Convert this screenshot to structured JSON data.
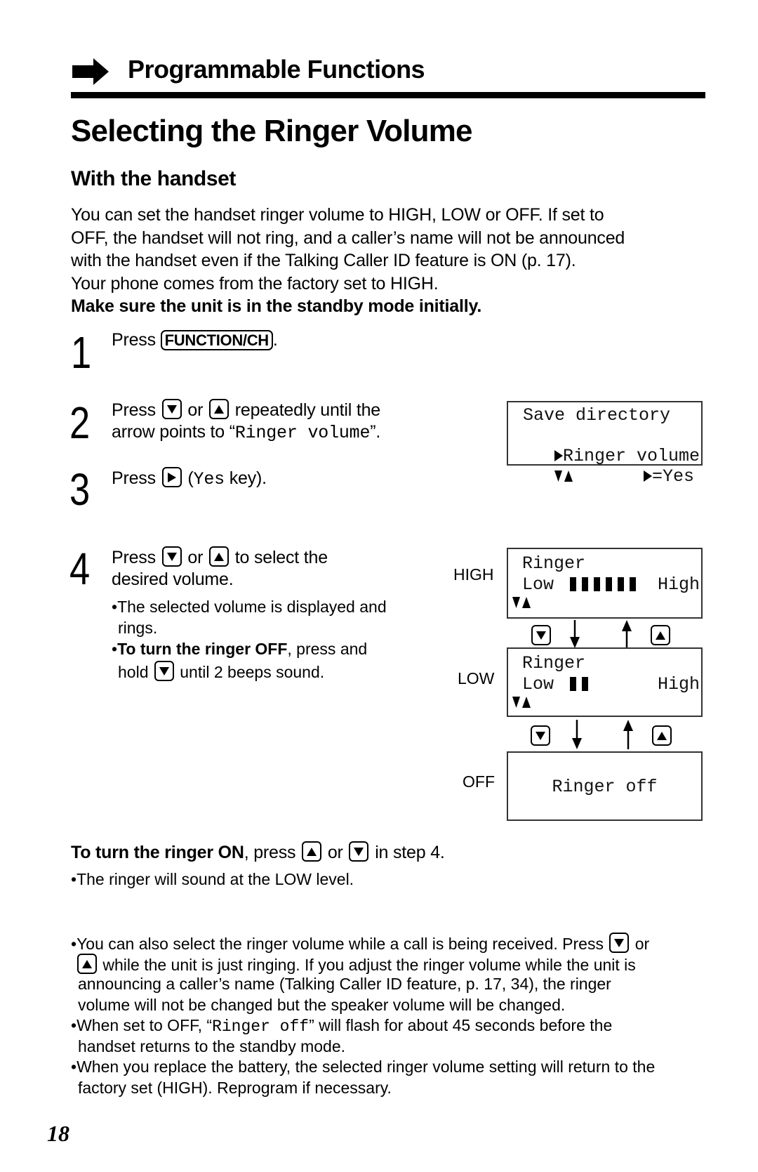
{
  "header": {
    "icon": "right-arrow-icon",
    "section": "Programmable Functions"
  },
  "title": "Selecting the Ringer Volume",
  "subheading": "With the handset",
  "intro": {
    "lines": [
      "You can set the handset ringer volume to HIGH, LOW or OFF. If set to",
      "OFF, the handset will not ring, and a caller’s name will not be announced",
      "with the handset even if the Talking Caller ID feature is ON (p. 17).",
      "Your phone comes from the factory set to HIGH."
    ],
    "bold_note": "Make sure the unit is in the standby mode initially."
  },
  "steps": [
    {
      "number": "1",
      "press": "Press",
      "key": "FUNCTION/CH",
      "after": "."
    },
    {
      "number": "2",
      "press": "Press",
      "or": "or",
      "line1_after": "repeatedly until the",
      "line2_before": "arrow points to “",
      "line2_mono": "Ringer volume",
      "line2_after": "”."
    },
    {
      "number": "3",
      "press": "Press",
      "paren_open": "(",
      "mono": "Yes",
      "after": " key)."
    },
    {
      "number": "4",
      "press": "Press",
      "or": "or",
      "line1_after": "to select the",
      "line2": "desired volume.",
      "bullets": [
        {
          "line1": "The selected volume is displayed and",
          "line2": "rings."
        },
        {
          "bold": "To turn the ringer OFF",
          "rest": ", press and",
          "line2_before": "hold",
          "line2_after": "until 2 beeps sound."
        }
      ]
    }
  ],
  "displays": {
    "menu": {
      "line1": " Save directory",
      "line2": "Ringer volume",
      "line3_right": "=Yes"
    },
    "high": {
      "label": "HIGH",
      "line1": "Ringer",
      "low": "Low",
      "high": "High",
      "level_bars": 6
    },
    "low": {
      "label": "LOW",
      "line1": "Ringer",
      "low": "Low",
      "high": "High",
      "level_bars": 2
    },
    "off": {
      "label": "OFF",
      "text": "Ringer off"
    }
  },
  "ringer_on": {
    "bold": "To turn the ringer ON",
    "press": ", press",
    "or": "or",
    "after": "in step 4.",
    "bullet": "The ringer will sound at the LOW level."
  },
  "notes": [
    {
      "before": "You can also select the ringer volume while a call is being received. Press",
      "or": "or",
      "line2": "while the unit is just ringing. If you adjust the ringer volume while the unit is",
      "line3": "announcing a caller’s name (Talking Caller ID feature, p. 17, 34), the ringer",
      "line4": "volume will not be changed but the speaker volume will be changed."
    },
    {
      "before": "When set to OFF, “",
      "mono": "Ringer off",
      "after": "” will flash for about 45 seconds before the",
      "line2": "handset returns to the standby mode."
    },
    {
      "line1": "When you replace the battery, the selected ringer volume setting will return to the",
      "line2": "factory set (HIGH). Reprogram if necessary."
    }
  ],
  "page_number": "18"
}
